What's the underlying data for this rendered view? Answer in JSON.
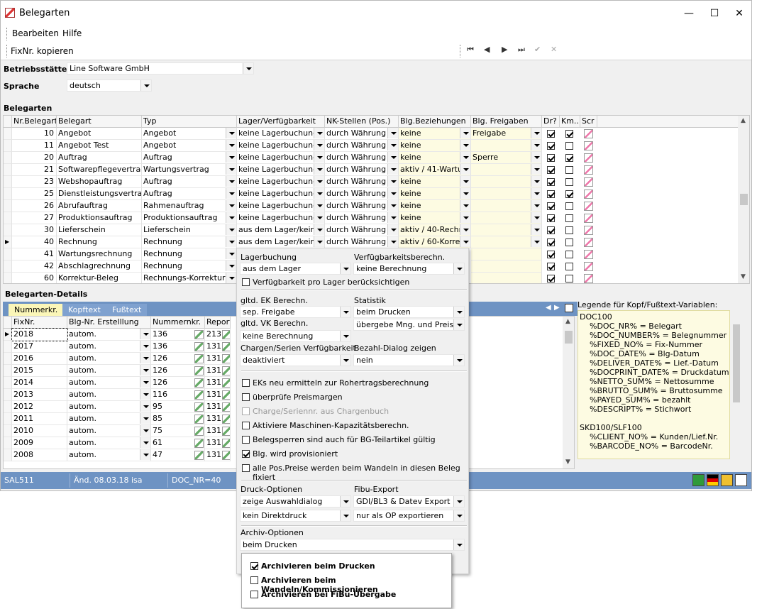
{
  "window": {
    "title": "Belegarten"
  },
  "menu": [
    "Bearbeiten",
    "Hilfe"
  ],
  "toolbar": {
    "fix_copy": "FixNr. kopieren",
    "nav": [
      "⏮",
      "◀",
      "▶",
      "⏭",
      "✔",
      "✕"
    ]
  },
  "form": {
    "betriebsstaette_label": "Betriebsstätte",
    "betriebsstaette_value": "Line Software GmbH",
    "sprache_label": "Sprache",
    "sprache_value": "deutsch"
  },
  "section_belegarten": "Belegarten",
  "grid": {
    "columns": [
      "Nr.Belegart",
      "Belegart",
      "Typ",
      "Lager/Verfügbarkeit",
      "NK-Stellen (Pos.)",
      "Blg.Beziehungen",
      "Blg. Freigaben",
      "Dr?",
      "Km...",
      "Scr"
    ],
    "rows": [
      {
        "nr": "10",
        "belegart": "Angebot",
        "typ": "Angebot",
        "lager": "keine Lagerbuchung/k",
        "nk": "durch Währung",
        "bez": "keine",
        "frei": "Freigabe",
        "dr": true,
        "km": true
      },
      {
        "nr": "11",
        "belegart": "Angebot Test",
        "typ": "Angebot",
        "lager": "keine Lagerbuchung/k",
        "nk": "durch Währung",
        "bez": "keine",
        "frei": "",
        "dr": true,
        "km": false
      },
      {
        "nr": "20",
        "belegart": "Auftrag",
        "typ": "Auftrag",
        "lager": "keine Lagerbuchung/N",
        "nk": "durch Währung",
        "bez": "keine",
        "frei": "Sperre",
        "dr": true,
        "km": true
      },
      {
        "nr": "21",
        "belegart": "Softwarepflegevertrag",
        "typ": "Wartungsvertrag",
        "lager": "keine Lagerbuchung/k",
        "nk": "durch Währung",
        "bez": "aktiv / 41-Wartur",
        "frei": "",
        "dr": true,
        "km": false
      },
      {
        "nr": "23",
        "belegart": "Webshopauftrag",
        "typ": "Auftrag",
        "lager": "keine Lagerbuchung/k",
        "nk": "durch Währung",
        "bez": "keine",
        "frei": "",
        "dr": true,
        "km": false
      },
      {
        "nr": "25",
        "belegart": "Dienstleistungsvertrag",
        "typ": "Auftrag",
        "lager": "keine Lagerbuchung/k",
        "nk": "durch Währung",
        "bez": "keine",
        "frei": "",
        "dr": true,
        "km": true
      },
      {
        "nr": "26",
        "belegart": "Abrufauftrag",
        "typ": "Rahmenauftrag",
        "lager": "keine Lagerbuchung/k",
        "nk": "durch Währung",
        "bez": "keine",
        "frei": "",
        "dr": true,
        "km": false
      },
      {
        "nr": "27",
        "belegart": "Produktionsauftrag",
        "typ": "Produktionsauftrag",
        "lager": "keine Lagerbuchung/k",
        "nk": "durch Währung",
        "bez": "keine",
        "frei": "",
        "dr": true,
        "km": false
      },
      {
        "nr": "30",
        "belegart": "Lieferschein",
        "typ": "Lieferschein",
        "lager": "aus dem Lager/keine",
        "nk": "durch Währung",
        "bez": "aktiv / 40-Rechnu",
        "frei": "",
        "dr": true,
        "km": false
      },
      {
        "nr": "40",
        "belegart": "Rechnung",
        "typ": "Rechnung",
        "lager": "aus dem Lager/keine",
        "nk": "durch Währung",
        "bez": "aktiv / 60-Korrek",
        "frei": "",
        "dr": true,
        "km": false
      },
      {
        "nr": "41",
        "belegart": "Wartungsrechnung",
        "typ": "Rechnung",
        "lager": "",
        "nk": "",
        "bez": "",
        "frei": "",
        "dr": true,
        "km": false
      },
      {
        "nr": "42",
        "belegart": "Abschlagrechnung",
        "typ": "Rechnung",
        "lager": "",
        "nk": "",
        "bez": "",
        "frei": "",
        "dr": true,
        "km": false
      },
      {
        "nr": "60",
        "belegart": "Korrektur-Beleg",
        "typ": "Rechnungs-Korrektur",
        "lager": "",
        "nk": "",
        "bez": "",
        "frei": "",
        "dr": true,
        "km": false
      }
    ]
  },
  "details": {
    "title": "Belegarten-Details",
    "tabs": [
      "Nummerkr.",
      "Kopftext",
      "Fußtext"
    ],
    "columns": [
      "FixNr.",
      "Blg-Nr. Erstelllung",
      "Nummernkr.",
      "Report"
    ],
    "rows": [
      {
        "fix": "2018",
        "erst": "autom.",
        "nk": "136",
        "rep": "213"
      },
      {
        "fix": "2017",
        "erst": "autom.",
        "nk": "136",
        "rep": "131"
      },
      {
        "fix": "2016",
        "erst": "autom.",
        "nk": "126",
        "rep": "131"
      },
      {
        "fix": "2015",
        "erst": "autom.",
        "nk": "126",
        "rep": "131"
      },
      {
        "fix": "2014",
        "erst": "autom.",
        "nk": "126",
        "rep": "131"
      },
      {
        "fix": "2013",
        "erst": "autom.",
        "nk": "116",
        "rep": "131"
      },
      {
        "fix": "2012",
        "erst": "autom.",
        "nk": "95",
        "rep": "131"
      },
      {
        "fix": "2011",
        "erst": "autom.",
        "nk": "85",
        "rep": "131"
      },
      {
        "fix": "2010",
        "erst": "autom.",
        "nk": "75",
        "rep": "131"
      },
      {
        "fix": "2009",
        "erst": "autom.",
        "nk": "61",
        "rep": "131"
      },
      {
        "fix": "2008",
        "erst": "autom.",
        "nk": "47",
        "rep": "131"
      }
    ]
  },
  "legend": {
    "title": "Legende für Kopf/Fußtext-Variablen:",
    "text": "DOC100\n    %DOC_NR% = Belegart\n    %DOC_NUMBER% = Belegnummer\n    %FIXED_NO% = Fix-Nummer\n    %DOC_DATE% = Blg-Datum\n    %DELIVER_DATE% = Lief.-Datum\n    %DOCPRINT_DATE% = Druckdatum\n    %NETTO_SUM% = Nettosumme\n    %BRUTTO_SUM% = Bruttosumme\n    %PAYED_SUM% = bezahlt\n    %DESCRIPT% = Stichwort\n\nSKD100/SLF100\n    %CLIENT_NO% = Kunden/Lief.Nr.\n    %BARCODE_NO% = BarcodeNr."
  },
  "status": {
    "code": "SAL511",
    "changed": "Änd. 08.03.18 isa",
    "doc": "DOC_NR=40"
  },
  "popup": {
    "lagerbuchung_label": "Lagerbuchung",
    "lagerbuchung_value": "aus dem Lager",
    "verf_label": "Verfügbarkeitsberechn.",
    "verf_value": "keine Berechnung",
    "verf_lager": "Verfügbarkeit pro Lager berücksichtigen",
    "ek_label": "gltd. EK Berechn.",
    "ek_value": "sep. Freigabe",
    "statistik_label": "Statistik",
    "statistik_value": "beim Drucken",
    "vk_label": "gltd. VK Berechn.",
    "vk_value": "keine Berechnung",
    "mng_value": "übergebe Mng. und Preis",
    "chargen_label": "Chargen/Serien Verfügbarkeit",
    "chargen_value": "deaktiviert",
    "bezahl_label": "Bezahl-Dialog zeigen",
    "bezahl_value": "nein",
    "checks": [
      {
        "label": "EKs neu ermitteln zur Rohertragsberechnung",
        "on": false,
        "dis": false
      },
      {
        "label": "überprüfe Preismargen",
        "on": false,
        "dis": false
      },
      {
        "label": "Charge/Seriennr. aus Chargenbuch",
        "on": false,
        "dis": true
      },
      {
        "label": "Aktiviere Maschinen-Kapazitätsberechn.",
        "on": false,
        "dis": false
      },
      {
        "label": "Belegsperren sind auch für BG-Teilartikel gültig",
        "on": false,
        "dis": false
      },
      {
        "label": "Blg. wird provisioniert",
        "on": true,
        "dis": false
      },
      {
        "label": "alle Pos.Preise werden beim Wandeln in diesen Beleg fixiert",
        "on": false,
        "dis": false
      }
    ],
    "druck_label": "Druck-Optionen",
    "druck_value": "zeige Auswahldialog",
    "fibu_label": "Fibu-Export",
    "fibu_value": "GDI/BL3 & Datev Export",
    "direkt_value": "kein Direktdruck",
    "op_value": "nur als OP exportieren",
    "archiv_label": "Archiv-Optionen",
    "archiv_value": "beim Drucken"
  },
  "submenu": [
    {
      "label": "Archivieren beim Drucken",
      "on": true
    },
    {
      "label": "Archivieren beim Wandeln/Kommissionieren",
      "on": false
    },
    {
      "label": "Archivieren bei FiBu-Übergabe",
      "on": false
    }
  ]
}
